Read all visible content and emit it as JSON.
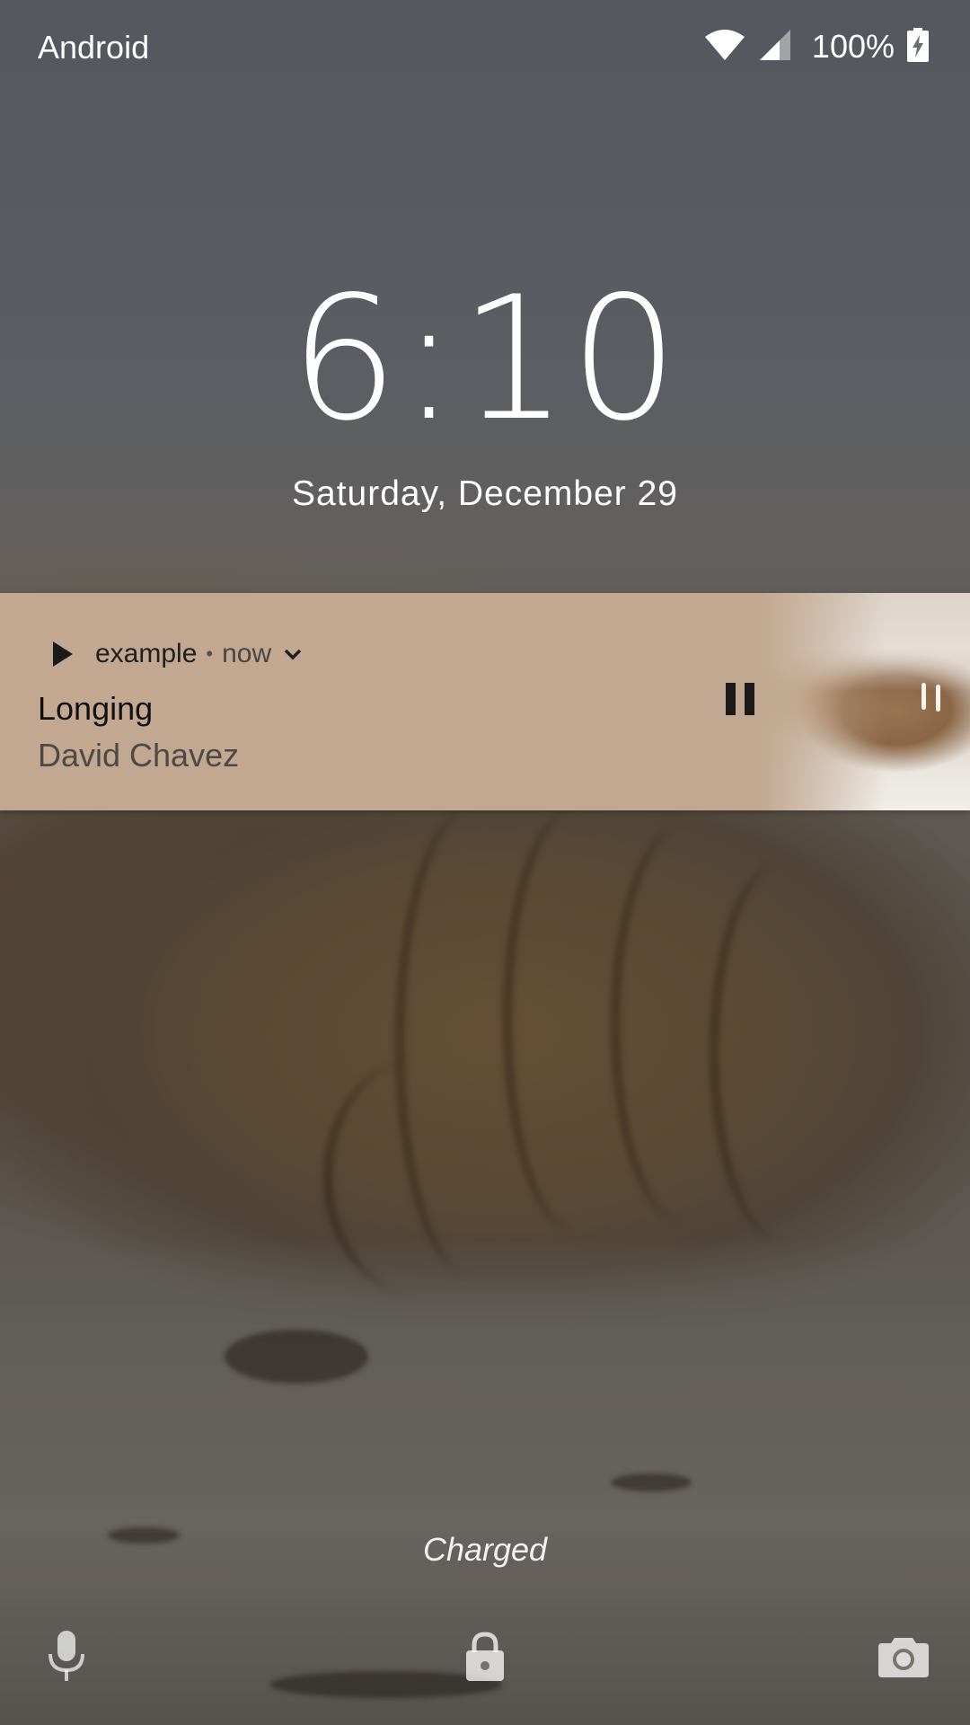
{
  "status_bar": {
    "carrier": "Android",
    "battery_percent": "100%",
    "wifi_icon": "wifi-icon",
    "signal_icon": "cell-signal-icon",
    "battery_icon": "battery-charging-icon"
  },
  "lockscreen": {
    "time": "6:10",
    "date": "Saturday, December 29",
    "charging_status": "Charged"
  },
  "media_notification": {
    "app_name": "example",
    "separator": "•",
    "time": "now",
    "title": "Longing",
    "artist": "David Chavez",
    "app_icon": "play-icon",
    "action_icon": "pause-icon",
    "background_color": "#c2a890"
  },
  "bottom_shortcuts": {
    "left": "microphone-icon",
    "center": "lock-icon",
    "right": "camera-icon"
  }
}
